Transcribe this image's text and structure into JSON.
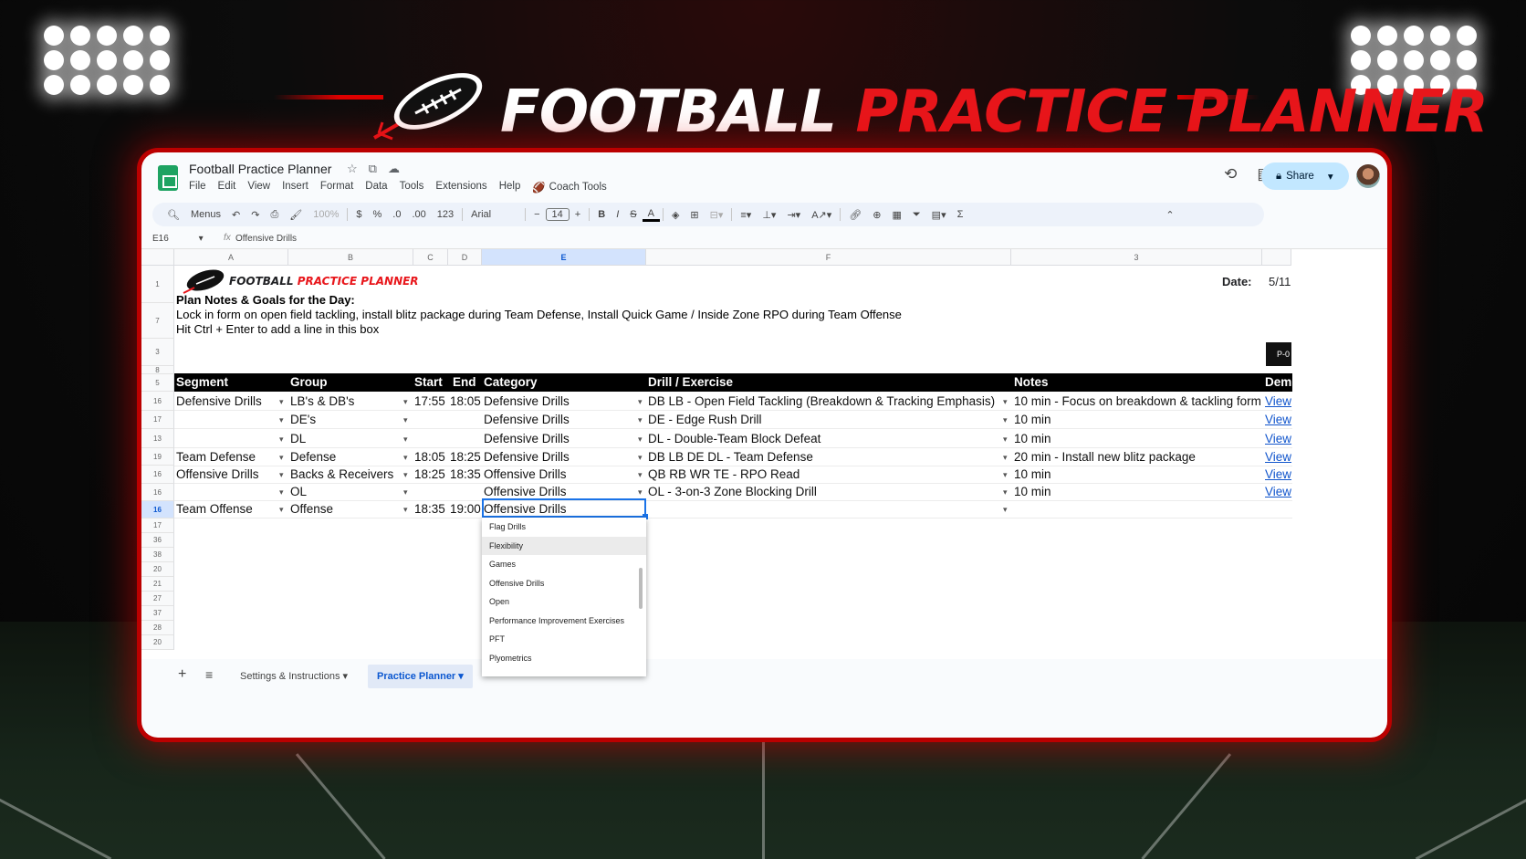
{
  "banner": {
    "title_white": "FOOTBALL",
    "title_red": "PRACTICE PLANNER",
    "accent": "#e8161b"
  },
  "app": {
    "doc_title": "Football Practice Planner",
    "menus": [
      "File",
      "Edit",
      "View",
      "Insert",
      "Format",
      "Data",
      "Tools",
      "Extensions",
      "Help"
    ],
    "coach_tools": "Coach Tools",
    "share_label": "Share",
    "toolbar": {
      "menus": "Menus",
      "zoom": "100%",
      "currency": "$",
      "percent": "%",
      "dec_less": ".0",
      "dec_more": ".00",
      "number_fmt": "123",
      "font": "Arial",
      "font_size": "14",
      "bold": "B",
      "italic": "I",
      "strike": "S",
      "text_color": "A"
    },
    "formula": {
      "cell_ref": "E16",
      "fx": "fx",
      "value": "Offensive Drills"
    }
  },
  "columns": [
    "A",
    "B",
    "C",
    "D",
    "E",
    "F",
    "3"
  ],
  "row_numbers": [
    "1",
    "7",
    "3",
    "8",
    "5",
    "16",
    "17",
    "13",
    "19",
    "16",
    "16",
    "16",
    "17",
    "36",
    "38",
    "20",
    "21",
    "27",
    "37",
    "28",
    "20"
  ],
  "sheet": {
    "logo_white": "FOOTBALL",
    "logo_red": "PRACTICE PLANNER",
    "date_label": "Date:",
    "date_value": "5/11",
    "notes_heading": "Plan Notes & Goals for the Day:",
    "notes_line1": "Lock in form on open field tackling, install blitz package during Team Defense, Install Quick Game / Inside Zone RPO during Team Offense",
    "notes_line2": "Hit Ctrl + Enter to add a line in this box",
    "corner_button": "P-0",
    "headers": {
      "segment": "Segment",
      "group": "Group",
      "start": "Start",
      "end": "End",
      "category": "Category",
      "drill": "Drill / Exercise",
      "notes": "Notes",
      "demo": "Dem"
    },
    "rows": [
      {
        "segment": "Defensive Drills",
        "group": "LB's & DB's",
        "start": "17:55",
        "end": "18:05",
        "category": "Defensive Drills",
        "drill": "DB LB - Open Field Tackling (Breakdown & Tracking Emphasis)",
        "notes": "10 min - Focus on breakdown & tackling form",
        "link": "View"
      },
      {
        "segment": "",
        "group": "DE's",
        "start": "",
        "end": "",
        "category": "Defensive Drills",
        "drill": "DE - Edge Rush Drill",
        "notes": "10 min",
        "link": "View"
      },
      {
        "segment": "",
        "group": "DL",
        "start": "",
        "end": "",
        "category": "Defensive Drills",
        "drill": "DL - Double-Team Block Defeat",
        "notes": "10 min",
        "link": "View"
      },
      {
        "segment": "Team Defense",
        "group": "Defense",
        "start": "18:05",
        "end": "18:25",
        "category": "Defensive Drills",
        "drill": "DB LB DE DL - Team Defense",
        "notes": "20 min - Install new blitz package",
        "link": "View"
      },
      {
        "segment": "Offensive Drills",
        "group": "Backs & Receivers",
        "start": "18:25",
        "end": "18:35",
        "category": "Offensive Drills",
        "drill": "QB RB WR TE - RPO Read",
        "notes": "10 min",
        "link": "View"
      },
      {
        "segment": "",
        "group": "OL",
        "start": "",
        "end": "",
        "category": "Offensive Drills",
        "drill": "OL - 3-on-3 Zone Blocking Drill",
        "notes": "10 min",
        "link": "View"
      },
      {
        "segment": "Team Offense",
        "group": "Offense",
        "start": "18:35",
        "end": "19:00",
        "category": "Offensive Drills",
        "drill": "",
        "notes": "",
        "link": ""
      }
    ]
  },
  "dropdown_options": [
    "Flag Drills",
    "Flexibility",
    "Games",
    "Offensive Drills",
    "Open",
    "Performance Improvement Exercises",
    "PFT",
    "Plyometrics"
  ],
  "tabs": {
    "settings": "Settings & Instructions",
    "planner": "Practice Planner"
  }
}
